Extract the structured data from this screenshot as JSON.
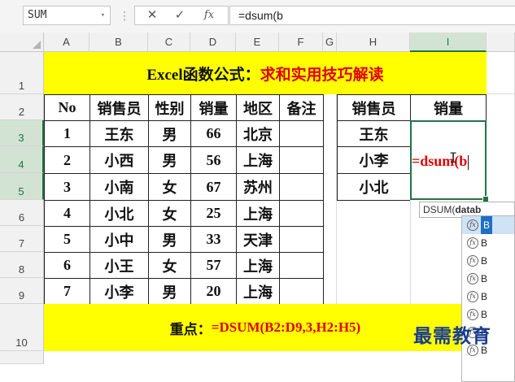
{
  "formula_bar": {
    "name_box": "SUM",
    "name_box_arrow": "▾",
    "grip": "⋮",
    "cancel": "✕",
    "enter": "✓",
    "fx": "fx",
    "formula": "=dsum(b"
  },
  "columns": [
    "A",
    "B",
    "C",
    "D",
    "E",
    "F",
    "G",
    "H",
    "I"
  ],
  "rows": [
    "1",
    "2",
    "3",
    "4",
    "5",
    "6",
    "7",
    "8",
    "9",
    "10"
  ],
  "title": {
    "black": "Excel函数公式：",
    "red": "求和实用技巧解读"
  },
  "table": {
    "headers": [
      "No",
      "销售员",
      "性别",
      "销量",
      "地区",
      "备注"
    ],
    "rows": [
      [
        "1",
        "王东",
        "男",
        "66",
        "北京",
        ""
      ],
      [
        "2",
        "小西",
        "男",
        "56",
        "上海",
        ""
      ],
      [
        "3",
        "小南",
        "女",
        "67",
        "苏州",
        ""
      ],
      [
        "4",
        "小北",
        "女",
        "25",
        "上海",
        ""
      ],
      [
        "5",
        "小中",
        "男",
        "33",
        "天津",
        ""
      ],
      [
        "6",
        "小王",
        "女",
        "57",
        "上海",
        ""
      ],
      [
        "7",
        "小李",
        "男",
        "20",
        "上海",
        ""
      ]
    ]
  },
  "criteria": {
    "headers": [
      "销售员",
      "销量"
    ],
    "names": [
      "王东",
      "小李",
      "小北"
    ]
  },
  "editing": {
    "text": "=dsum(b"
  },
  "ibeam": "I",
  "tooltip": {
    "prefix": "DSUM(",
    "bold": "datab"
  },
  "autocomplete": {
    "items": [
      "B",
      "B",
      "B",
      "B",
      "B",
      "B",
      "B",
      "B"
    ]
  },
  "note": {
    "black": "重点：",
    "red": "=DSUM(B2:D9,3,H2:H5)"
  },
  "watermark": "最需教育"
}
